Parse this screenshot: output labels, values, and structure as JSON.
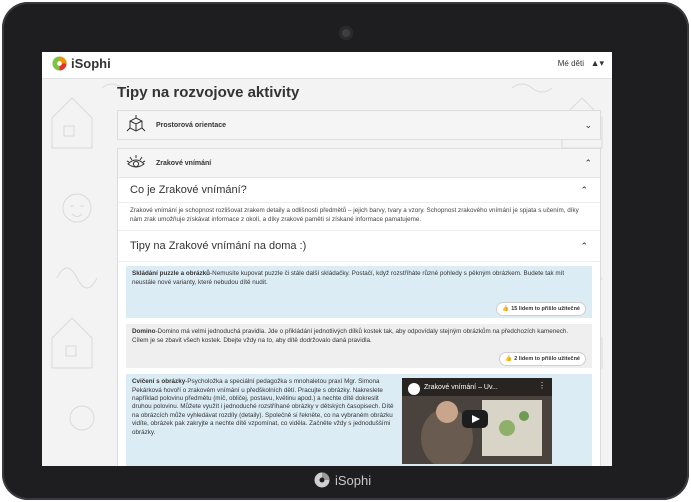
{
  "app": {
    "name": "iSophi"
  },
  "topbar": {
    "my_children": "Mé děti",
    "user_menu": "▲▾"
  },
  "page": {
    "title": "Tipy na rozvojove aktivity"
  },
  "sections": [
    {
      "label": "Prostorová orientace",
      "icon": "cube-icon",
      "state": "collapsed"
    },
    {
      "label": "Zrakové vnímání",
      "icon": "eye-icon",
      "state": "expanded"
    }
  ],
  "what_is": {
    "title": "Co je Zrakové vnímání?",
    "text": "Zrakové vnímání je schopnost rozlišovat zrakem detaily a odlišnosti předmětů – jejich barvy, tvary a vzory. Schopnost zrakového vnímání je spjata s učením, díky nám zrak umožňuje získávat informace z okolí, a díky zrakové paměti si získané informace pamatujeme."
  },
  "home_tips": {
    "title": "Tipy na Zrakové vnímání na doma :)",
    "tips": [
      {
        "title": "Skládání puzzle a obrázků",
        "text": "-Nemusíte kupovat puzzle či stále další skládačky. Postačí, když rozstříháte různé pohledy s pěkným obrázkem. Budete tak mít neustále nové varianty, které nebudou dítě nudit.",
        "useful": "15 lidem to přišlo užitečné"
      },
      {
        "title": "Domino",
        "text": "-Domino má velmi jednoduchá pravidla. Jde o přikládání jednotlivých dílků kostek tak, aby odpovídaly stejným obrázkům na předchozích kamenech. Cílem je se zbavit všech kostek. Dbejte vždy na to, aby dítě dodržovalo daná pravidla.",
        "useful": "2 lidem to přišlo užitečné"
      },
      {
        "title": "Cvičení s obrázky",
        "text": "-Psycholožka a speciální pedagožka s mnohaletou praxí Mgr. Simona Pekárková hovoří o zrakovém vnímání u předškolních dětí. Pracujte s obrázky. Nakreslete například polovinu předmětu (míč, obličej, postavu, květinu apod.) a nechte dítě dokreslit druhou polovinu. Můžete využít i jednoduché rozstříhané obrázky v dětských časopisech. Dítě na obrázcích může vyhledávat rozdíly (detaily). Společně si řekněte, co na vybraném obrázku vidíte, obrázek pak zakryjte a nechte dítě vzpomínat, co viděla. Začněte vždy s jednoduššími obrázky.",
        "video_title": "Zrakové vnímání – Uv..."
      }
    ]
  },
  "colors": {
    "accent_blue": "#dcecf5",
    "tablet_frame": "#1e1e20",
    "logo_green": "#7dc243",
    "logo_orange": "#f39200"
  }
}
